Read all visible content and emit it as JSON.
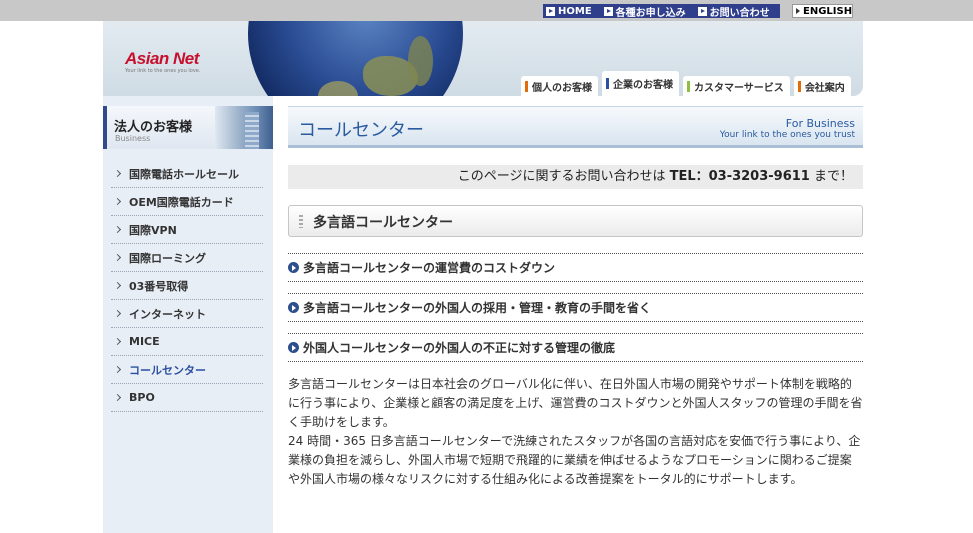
{
  "util_nav": {
    "home": "HOME",
    "apply": "各種お申し込み",
    "contact": "お問い合わせ",
    "english": "ENGLISH"
  },
  "header": {
    "logo_text": "Asian Net",
    "logo_tagline": "Your link to the ones you love.",
    "tabs": [
      {
        "label": "個人のお客様",
        "color": "#e36c0a"
      },
      {
        "label": "企業のお客様",
        "color": "#2a4fa1"
      },
      {
        "label": "カスタマーサービス",
        "color": "#8cbf3f"
      },
      {
        "label": "会社案内",
        "color": "#e36c0a"
      }
    ]
  },
  "sidebar": {
    "title": "法人のお客様",
    "subtitle": "Business",
    "items": [
      "国際電話ホールセール",
      "OEM国際電話カード",
      "国際VPN",
      "国際ローミング",
      "03番号取得",
      "インターネット",
      "MICE",
      "コールセンター",
      "BPO"
    ],
    "active_index": 7
  },
  "main": {
    "page_title": "コールセンター",
    "banner_en_1": "For Business",
    "banner_en_2": "Your link to the ones you trust",
    "contact_prefix": "このページに関するお問い合わせは ",
    "contact_tel": "TEL：03-3203-9611",
    "contact_suffix": " まで！",
    "section_title": "多言語コールセンター",
    "links": [
      "多言語コールセンターの運営費のコストダウン",
      "多言語コールセンターの外国人の採用・管理・教育の手間を省く",
      "外国人コールセンターの外国人の不正に対する管理の徹底"
    ],
    "paragraph1": "多言語コールセンターは日本社会のグローバル化に伴い、在日外国人市場の開発やサポート体制を戦略的に行う事により、企業様と顧客の満足度を上げ、運営費のコストダウンと外国人スタッフの管理の手間を省く手助けをします。",
    "paragraph2": "24 時間・365 日多言語コールセンターで洗練されたスタッフが各国の言語対応を安価で行う事により、企業様の負担を減らし、外国人市場で短期で飛躍的に業績を伸ばせるようなプロモーションに関わるご提案や外国人市場の様々なリスクに対する仕組み化による改善提案をトータル的にサポートします。"
  }
}
